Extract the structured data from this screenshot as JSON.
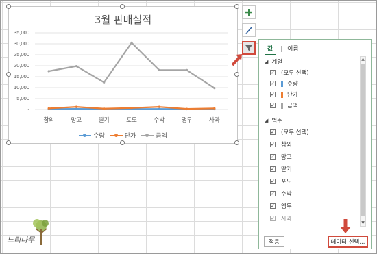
{
  "chart_data": {
    "type": "line",
    "title": "3월 판매실적",
    "categories": [
      "참외",
      "망고",
      "딸기",
      "포도",
      "수박",
      "앵두",
      "사과"
    ],
    "series": [
      {
        "name": "수량",
        "color": "#5b9bd5",
        "values": [
          200,
          300,
          150,
          200,
          250,
          150,
          150
        ]
      },
      {
        "name": "단가",
        "color": "#ed7d31",
        "values": [
          500,
          1200,
          400,
          700,
          1200,
          300,
          500
        ]
      },
      {
        "name": "금액",
        "color": "#a5a5a5",
        "values": [
          17500,
          19800,
          12400,
          30500,
          18000,
          18000,
          9800
        ]
      }
    ],
    "ytick_labels": [
      "35,000",
      "30,000",
      "25,000",
      "20,000",
      "15,000",
      "10,000",
      "5,000",
      "-"
    ],
    "ylim": [
      0,
      35000
    ],
    "grid": true,
    "legend": "bottom"
  },
  "side_buttons": {
    "add": {
      "icon": "plus-icon"
    },
    "style": {
      "icon": "brush-icon"
    },
    "filter": {
      "icon": "funnel-icon"
    }
  },
  "filter_panel": {
    "tabs": [
      "값",
      "이름"
    ],
    "active_tab": "값",
    "series_header": "계열",
    "category_header": "범주",
    "select_all": "(모두 선택)",
    "series": [
      {
        "label": "수량",
        "color": "#5b9bd5"
      },
      {
        "label": "단가",
        "color": "#ed7d31"
      },
      {
        "label": "금액",
        "color": "#a5a5a5"
      }
    ],
    "categories": [
      "참외",
      "망고",
      "딸기",
      "포도",
      "수박",
      "앵두",
      "사과"
    ],
    "apply_label": "적용",
    "select_data_label": "데이터 선택..."
  },
  "watermark": {
    "text": "느티나무"
  },
  "accent": {
    "annotation_red": "#d04a3c",
    "excel_green": "#217346"
  }
}
